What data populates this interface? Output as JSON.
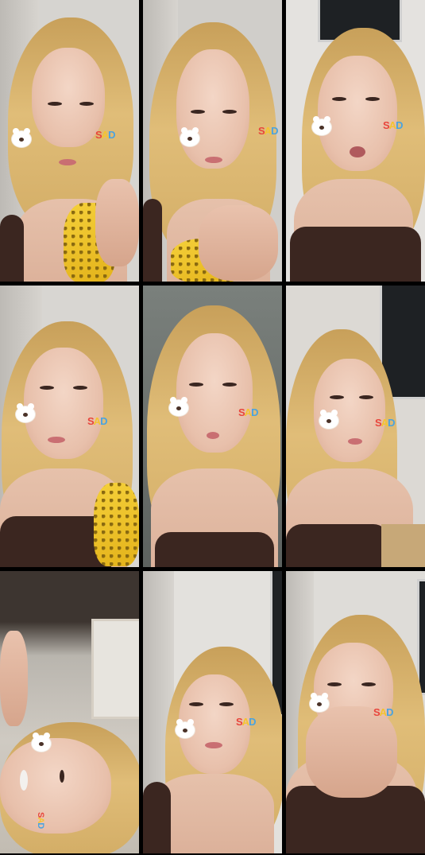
{
  "grid": {
    "cells": [
      {
        "id": 1,
        "sticker_text": {
          "s": "S",
          "a": "A",
          "d": "D"
        }
      },
      {
        "id": 2,
        "sticker_text": {
          "s": "S",
          "a": "A",
          "d": "D"
        }
      },
      {
        "id": 3,
        "sticker_text": {
          "s": "S",
          "a": "A",
          "d": "D"
        }
      },
      {
        "id": 4,
        "sticker_text": {
          "s": "S",
          "a": "A",
          "d": "D"
        }
      },
      {
        "id": 5,
        "sticker_text": {
          "s": "S",
          "a": "A",
          "d": "D"
        }
      },
      {
        "id": 6,
        "sticker_text": {
          "s": "S",
          "a": "A",
          "d": "D"
        }
      },
      {
        "id": 7,
        "sticker_text": {
          "s": "S",
          "a": "A",
          "d": "D"
        }
      },
      {
        "id": 8,
        "sticker_text": {
          "s": "S",
          "a": "A",
          "d": "D"
        }
      },
      {
        "id": 9,
        "sticker_text": {
          "s": "S",
          "a": "A",
          "d": "D"
        }
      }
    ]
  },
  "colors": {
    "background": "#000000",
    "hair": "#d9b26b",
    "top": "#3b2620",
    "sticker_s": "#e8453c",
    "sticker_a": "#f4c430",
    "sticker_d": "#4aa3e0"
  },
  "icons": [
    "bear-sticker-icon"
  ]
}
